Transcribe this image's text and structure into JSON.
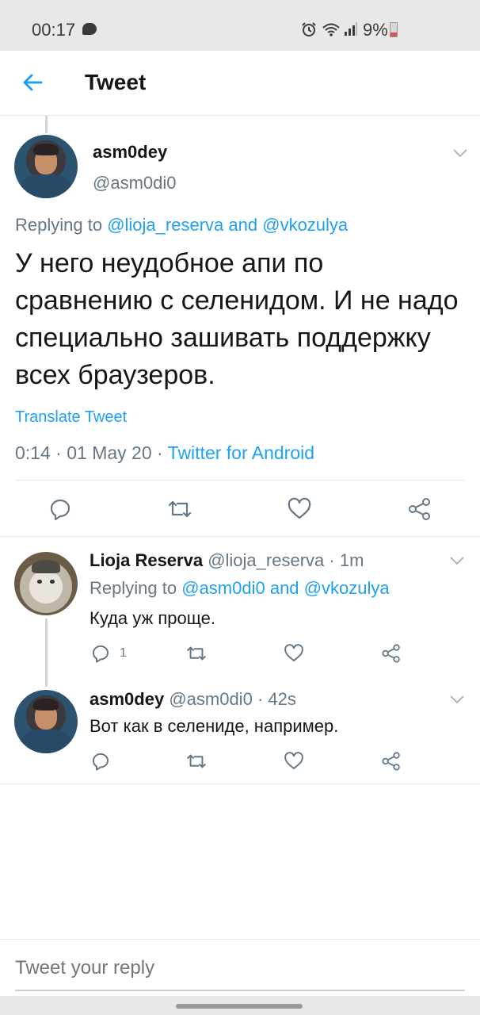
{
  "status_bar": {
    "time": "00:17",
    "battery": "9%",
    "chat_icon": "chat-bubble-icon",
    "alarm_icon": "alarm-icon",
    "wifi_icon": "wifi-icon",
    "signal_icon": "signal-icon"
  },
  "header": {
    "title": "Tweet",
    "back_icon": "arrow-left-icon"
  },
  "main_tweet": {
    "name": "asm0dey",
    "handle": "@asm0di0",
    "replying_prefix": "Replying to",
    "replying_user1": "@lioja_reserva",
    "replying_and": "and",
    "replying_user2": "@vkozulya",
    "text": "У него неудобное апи по сравнению с селенидом. И не надо специально зашивать поддержку всех браузеров.",
    "translate": "Translate Tweet",
    "time": "0:14",
    "date": "01 May 20",
    "separator": "·",
    "source": "Twitter for Android"
  },
  "replies": [
    {
      "name": "Lioja Reserva",
      "handle": "@lioja_reserva",
      "sep": "·",
      "time": "1m",
      "replying_prefix": "Replying to",
      "replying_user1": "@asm0di0",
      "replying_and": "and",
      "replying_user2": "@vkozulya",
      "text": "Куда уж проще.",
      "reply_count": "1"
    },
    {
      "name": "asm0dey",
      "handle": "@asm0di0",
      "sep": "·",
      "time": "42s",
      "text": "Вот как в селениде, например."
    }
  ],
  "compose": {
    "placeholder": "Tweet your reply"
  },
  "colors": {
    "accent": "#1da1f2",
    "muted": "#657786",
    "text": "#14171a",
    "divider": "#e1e8ed"
  }
}
